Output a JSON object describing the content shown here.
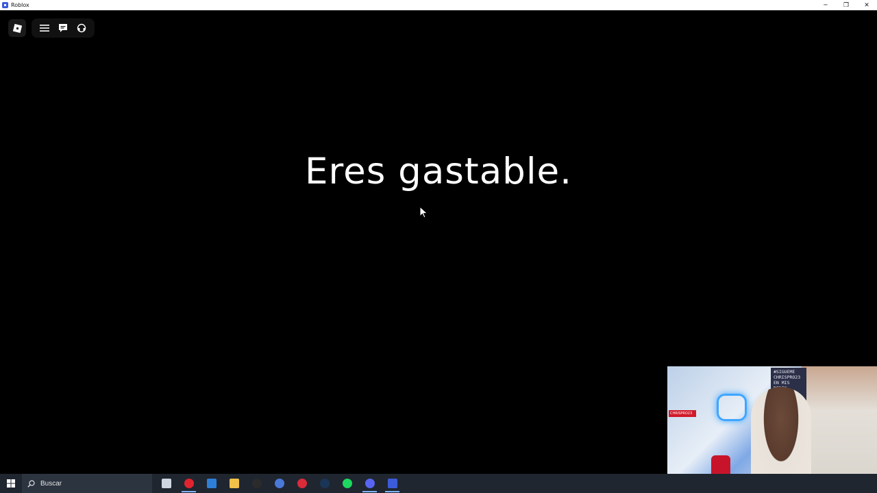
{
  "window": {
    "title": "Roblox",
    "minimize": "─",
    "restore": "❐",
    "close": "✕"
  },
  "game": {
    "message": "Eres gastable."
  },
  "webcam": {
    "sign_text": "#SIGUEME\nCHRISPRO23\nEN MIS\nREDES",
    "badge_text": "CHRISPRO23"
  },
  "taskbar": {
    "search_placeholder": "Buscar",
    "apps": [
      {
        "name": "task-view",
        "color": "#cfd6df"
      },
      {
        "name": "opera",
        "color": "#e0242f"
      },
      {
        "name": "outlook",
        "color": "#2f7fd6"
      },
      {
        "name": "file-explorer",
        "color": "#f2c14a"
      },
      {
        "name": "obs",
        "color": "#2b2b2b"
      },
      {
        "name": "wps",
        "color": "#4a78d8"
      },
      {
        "name": "wps-office",
        "color": "#d92b3a"
      },
      {
        "name": "steam",
        "color": "#1b3557"
      },
      {
        "name": "spotify",
        "color": "#1ed760"
      },
      {
        "name": "discord",
        "color": "#5865f2"
      },
      {
        "name": "roblox",
        "color": "#3b5bdb"
      }
    ]
  }
}
